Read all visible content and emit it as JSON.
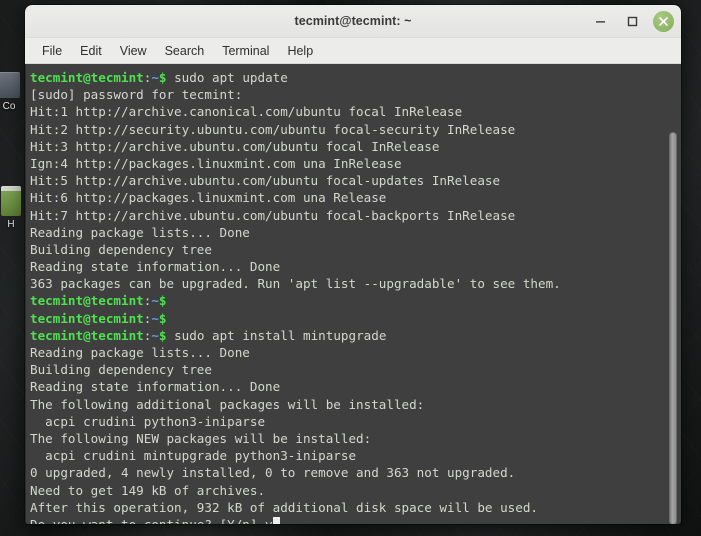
{
  "window": {
    "title": "tecmint@tecmint: ~",
    "controls": {
      "minimize": "–",
      "maximize": "□",
      "close": "✕"
    }
  },
  "menubar": {
    "items": [
      {
        "label": "File"
      },
      {
        "label": "Edit"
      },
      {
        "label": "View"
      },
      {
        "label": "Search"
      },
      {
        "label": "Terminal"
      },
      {
        "label": "Help"
      }
    ]
  },
  "desktop": {
    "icons": [
      {
        "name": "computer-icon",
        "label": "Co"
      },
      {
        "name": "home-icon",
        "label": "H"
      }
    ]
  },
  "terminal": {
    "prompt": {
      "user_host": "tecmint@tecmint",
      "colon": ":",
      "path": "~",
      "dollar": "$"
    },
    "colors": {
      "background": "#3f3f3f",
      "foreground": "#d3d7cf",
      "prompt_green": "#4ee24e",
      "path_blue": "#5f9ede",
      "cursor": "#eeeeec"
    },
    "lines": [
      {
        "type": "prompt",
        "command": " sudo apt update"
      },
      {
        "type": "out",
        "text": "[sudo] password for tecmint:"
      },
      {
        "type": "out",
        "text": "Hit:1 http://archive.canonical.com/ubuntu focal InRelease"
      },
      {
        "type": "out",
        "text": "Hit:2 http://security.ubuntu.com/ubuntu focal-security InRelease"
      },
      {
        "type": "out",
        "text": "Hit:3 http://archive.ubuntu.com/ubuntu focal InRelease"
      },
      {
        "type": "out",
        "text": "Ign:4 http://packages.linuxmint.com una InRelease"
      },
      {
        "type": "out",
        "text": "Hit:5 http://archive.ubuntu.com/ubuntu focal-updates InRelease"
      },
      {
        "type": "out",
        "text": "Hit:6 http://packages.linuxmint.com una Release"
      },
      {
        "type": "out",
        "text": "Hit:7 http://archive.ubuntu.com/ubuntu focal-backports InRelease"
      },
      {
        "type": "out",
        "text": "Reading package lists... Done"
      },
      {
        "type": "out",
        "text": "Building dependency tree"
      },
      {
        "type": "out",
        "text": "Reading state information... Done"
      },
      {
        "type": "out",
        "text": "363 packages can be upgraded. Run 'apt list --upgradable' to see them."
      },
      {
        "type": "prompt",
        "command": ""
      },
      {
        "type": "prompt",
        "command": ""
      },
      {
        "type": "prompt",
        "command": " sudo apt install mintupgrade"
      },
      {
        "type": "out",
        "text": "Reading package lists... Done"
      },
      {
        "type": "out",
        "text": "Building dependency tree"
      },
      {
        "type": "out",
        "text": "Reading state information... Done"
      },
      {
        "type": "out",
        "text": "The following additional packages will be installed:"
      },
      {
        "type": "out",
        "text": "  acpi crudini python3-iniparse"
      },
      {
        "type": "out",
        "text": "The following NEW packages will be installed:"
      },
      {
        "type": "out",
        "text": "  acpi crudini mintupgrade python3-iniparse"
      },
      {
        "type": "out",
        "text": "0 upgraded, 4 newly installed, 0 to remove and 363 not upgraded."
      },
      {
        "type": "out",
        "text": "Need to get 149 kB of archives."
      },
      {
        "type": "out",
        "text": "After this operation, 932 kB of additional disk space will be used."
      },
      {
        "type": "out-cursor",
        "text": "Do you want to continue? [Y/n] y"
      }
    ]
  }
}
